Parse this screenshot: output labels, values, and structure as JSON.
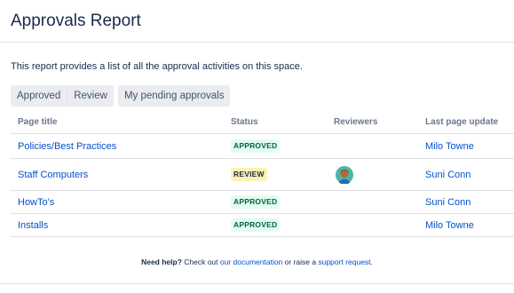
{
  "page": {
    "title": "Approvals Report",
    "description": "This report provides a list of all the approval activities on this space."
  },
  "tabs": {
    "approved": "Approved",
    "review": "Review",
    "my_pending": "My pending approvals"
  },
  "table": {
    "headers": [
      "Page title",
      "Status",
      "Reviewers",
      "Last page update"
    ],
    "rows": [
      {
        "title": "Policies/Best Practices",
        "status": "APPROVED",
        "status_type": "approved",
        "has_reviewer_avatar": false,
        "last_update": "Milo Towne"
      },
      {
        "title": "Staff Computers",
        "status": "REVIEW",
        "status_type": "review",
        "has_reviewer_avatar": true,
        "last_update": "Suni Conn"
      },
      {
        "title": "HowTo's",
        "status": "APPROVED",
        "status_type": "approved",
        "has_reviewer_avatar": false,
        "last_update": "Suni Conn"
      },
      {
        "title": "Installs",
        "status": "APPROVED",
        "status_type": "approved",
        "has_reviewer_avatar": false,
        "last_update": "Milo Towne"
      }
    ]
  },
  "footer": {
    "bold_text": "Need help?",
    "text_1": " Check out ",
    "doc_link": "our documentation",
    "text_2": " or raise a ",
    "support_link": "support request",
    "text_3": "."
  },
  "colors": {
    "link": "#0052cc",
    "approved_bg": "#e3fcef",
    "approved_text": "#006644",
    "review_bg": "#fff0b3"
  },
  "icons": {
    "reviewer_avatar": "avatar-icon"
  }
}
